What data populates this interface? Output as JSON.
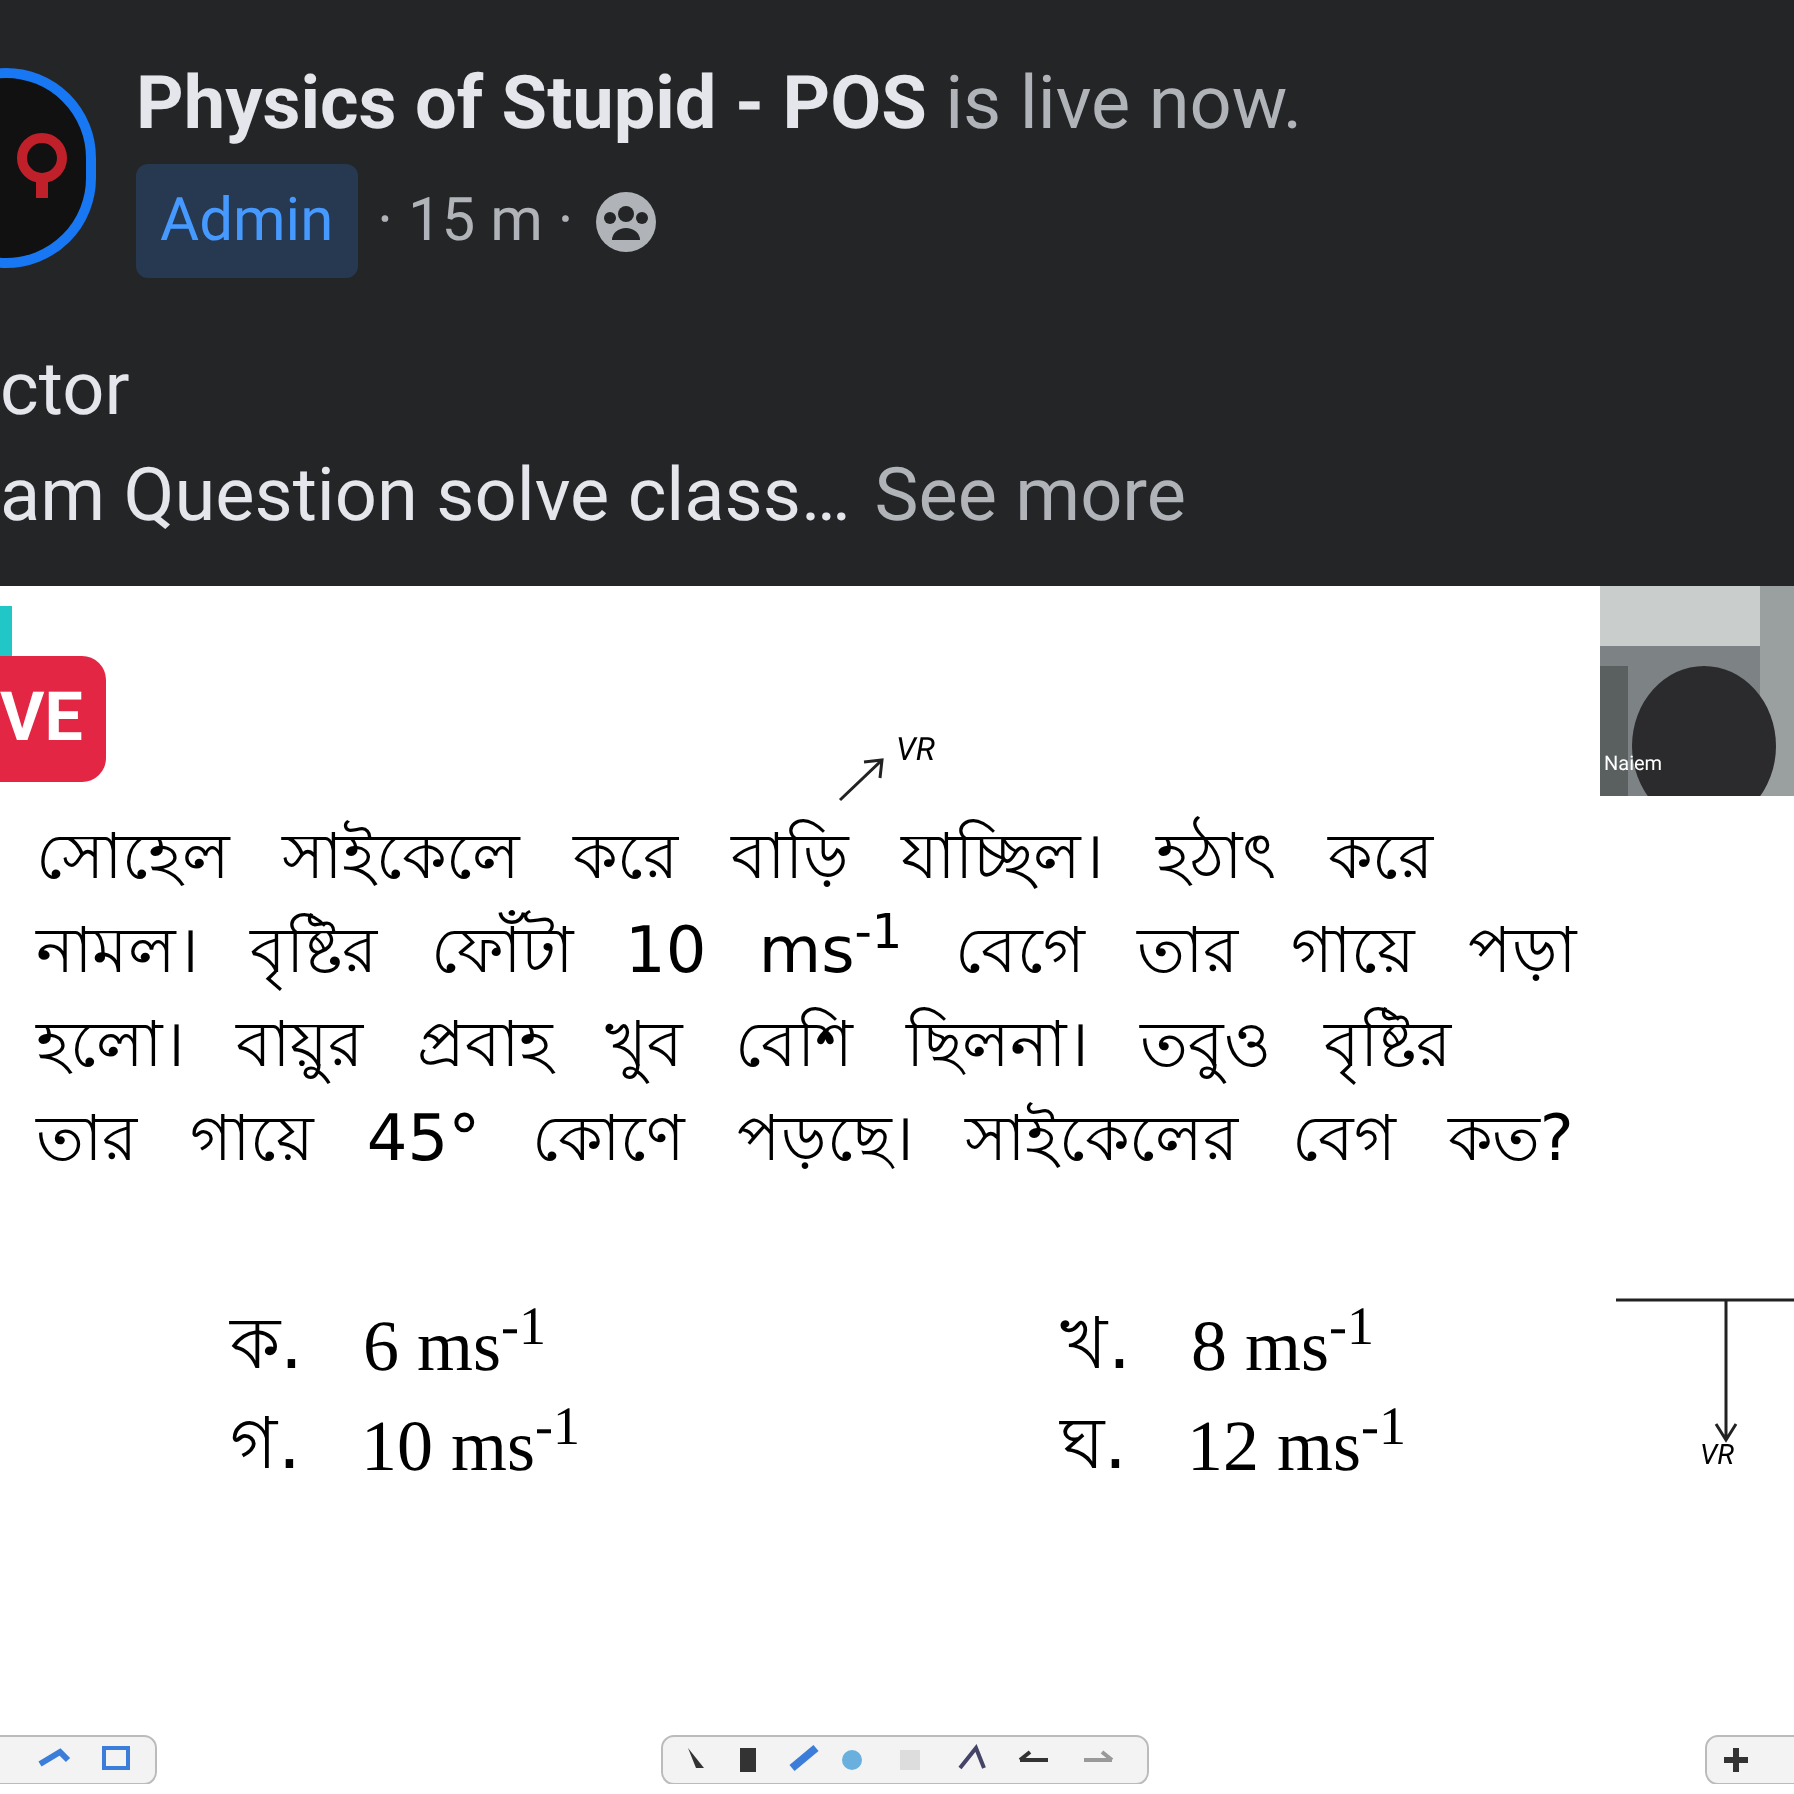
{
  "post": {
    "page_name": "Physics of Stupid - POS",
    "status": "is live now.",
    "badge": "Admin",
    "time": "· 15 m ·",
    "text_lines": [
      "ctor",
      "am Question solve class…"
    ],
    "see_more": "See more"
  },
  "video": {
    "live_badge": "VE",
    "camera_name": "Naiem",
    "question_lines": [
      "সোহেল সাইকেলে করে বাড়ি যাচ্ছিল। হঠাৎ করে",
      "নামল। বৃষ্টির ফোঁটা 10 ms$^{-1}$ বেগে তার গায়ে পড়া",
      "হলো। বায়ুর প্রবাহ খুব বেশি ছিলনা। তবুও বৃষ্টির",
      "তার গায়ে 45° কোণে পড়ছে। সাইকেলের বেগ কত?"
    ],
    "options": [
      {
        "letter": "ক.",
        "value": "6 ms$^{-1}$"
      },
      {
        "letter": "খ.",
        "value": "8 ms$^{-1}$"
      },
      {
        "letter": "গ.",
        "value": "10 ms$^{-1}$"
      },
      {
        "letter": "ঘ.",
        "value": "12 ms$^{-1}$"
      }
    ],
    "annotations": [
      "VR",
      "VR"
    ]
  }
}
